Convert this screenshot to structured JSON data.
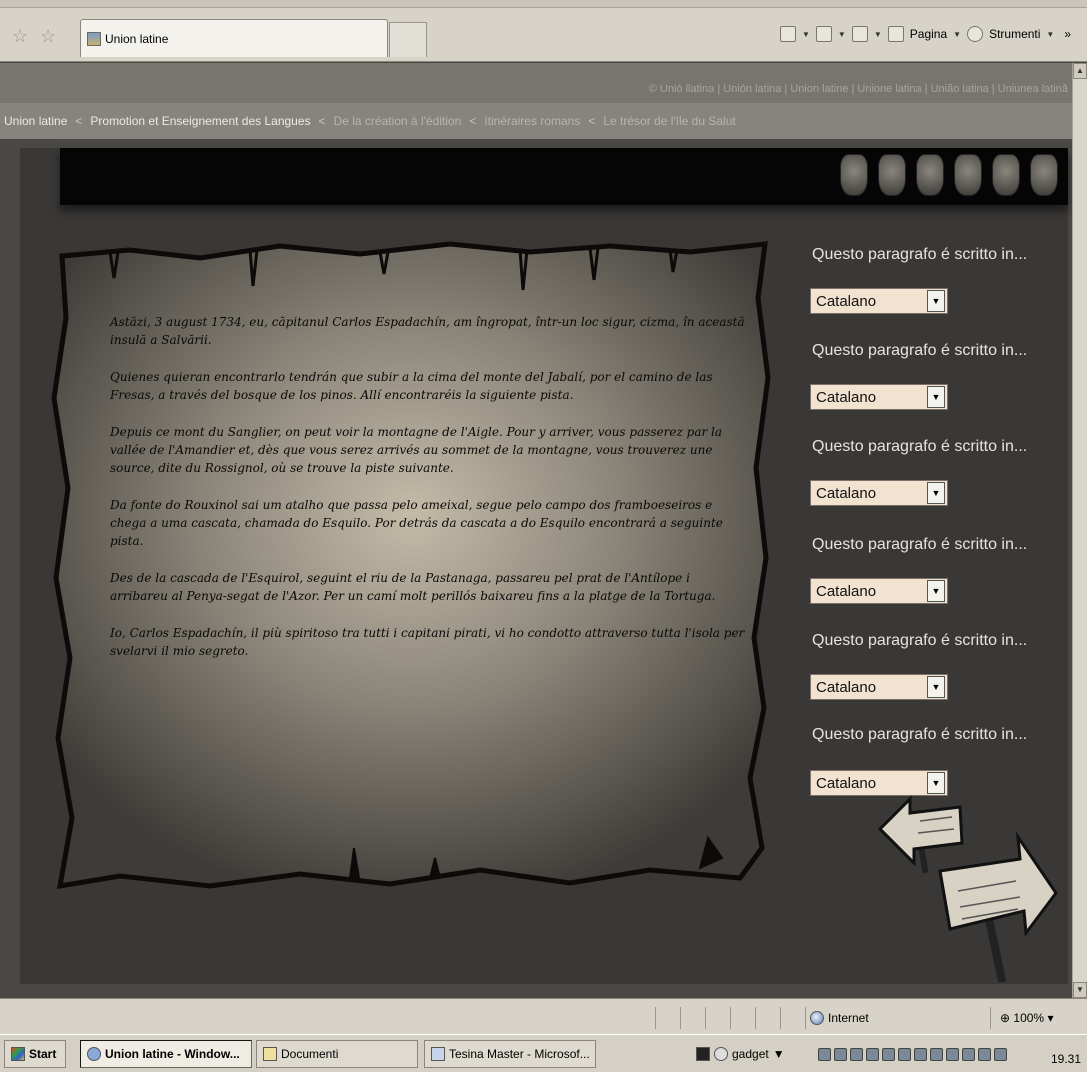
{
  "browser": {
    "tab_title": "Union latine",
    "commands": {
      "page": "Pagina",
      "tools": "Strumenti",
      "more": "»"
    }
  },
  "header": {
    "languages": "© Unió llatina | Unión latina | Union latine | Unione latina | União latina | Uniunea latină",
    "breadcrumb": [
      {
        "label": "Union latine",
        "sep": ""
      },
      {
        "label": "Promotion et Enseignement des Langues",
        "sep": "<"
      },
      {
        "label": "De la création à l'édition",
        "sep": "<"
      },
      {
        "label": "Itinéraires romans",
        "sep": "<"
      },
      {
        "label": "Le trésor de l'île du Salut",
        "sep": "<"
      }
    ]
  },
  "story": {
    "paragraphs": [
      "Astăzi, 3 august 1734, eu, căpitanul Carlos Espadachín, am îngropat, într-un loc sigur, cizma, în această insulă a Salvării.",
      "Quienes quieran encontrarlo tendrán que subir a la cima del monte del Jabalí, por el camino de las Fresas, a través del bosque de los pinos. Allí encontraréis la siguiente pista.",
      "Depuis ce mont du Sanglier, on peut voir la montagne de l'Aigle. Pour y arriver, vous passerez par la vallée de l'Amandier et, dès que vous serez arrivés au sommet de la montagne, vous trouverez une source, dite du Rossignol, où se trouve la piste suivante.",
      "Da fonte do Rouxinol sai um atalho que passa pelo ameixal, segue pelo campo dos framboeseiros e chega a uma cascata, chamada do Esquilo. Por detrás da cascata a do Esquilo encontrará  a seguinte pista.",
      "Des de la cascada de l'Esquirol, seguint el riu de la Pastanaga, passareu pel prat de l'Antílope i arribareu al Penya-segat de l'Azor. Per un camí molt perillós baixareu fins a la platge de la Tortuga.",
      "Io, Carlos Espadachín, il più spiritoso tra tutti i capitani pirati, vi ho condotto attraverso tutta l'isola per svelarvi il mio segreto."
    ]
  },
  "questions": [
    {
      "label": "Questo paragrafo é scritto in...",
      "selected": "Catalano"
    },
    {
      "label": "Questo paragrafo é scritto in...",
      "selected": "Catalano"
    },
    {
      "label": "Questo paragrafo é scritto in...",
      "selected": "Catalano"
    },
    {
      "label": "Questo paragrafo é scritto in...",
      "selected": "Catalano"
    },
    {
      "label": "Questo paragrafo é scritto in...",
      "selected": "Catalano"
    },
    {
      "label": "Questo paragrafo é scritto in...",
      "selected": "Catalano"
    }
  ],
  "statusbar": {
    "zone": "Internet",
    "zoom": "100%"
  },
  "taskbar": {
    "start": "Start",
    "buttons": [
      "Union latine - Window...",
      "Documenti",
      "Tesina Master - Microsof..."
    ],
    "gadget": "gadget",
    "clock": "19.31"
  },
  "colors": {
    "page_bg": "#3a3836",
    "header_bar": "#878480",
    "select_bg": "#f2e2d0"
  }
}
